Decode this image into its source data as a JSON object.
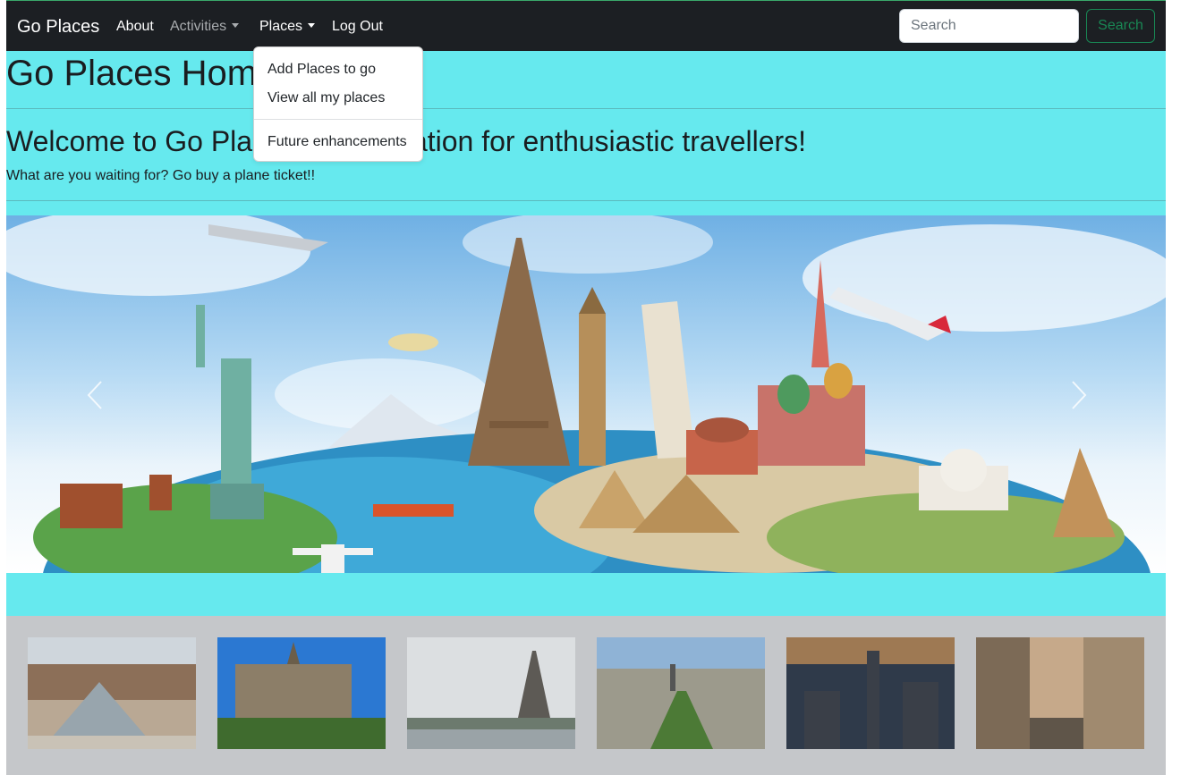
{
  "navbar": {
    "brand": "Go Places",
    "links": [
      {
        "label": "About"
      },
      {
        "label": "Activities"
      },
      {
        "label": "Places"
      },
      {
        "label": "Log Out"
      }
    ],
    "search": {
      "placeholder": "Search",
      "button_label": "Search"
    }
  },
  "dropdown": {
    "items": [
      {
        "label": "Add Places to go"
      },
      {
        "label": "View all my places"
      },
      {
        "label": "Future enhancements"
      }
    ]
  },
  "main": {
    "title": "Go Places Home",
    "welcome": "Welcome to Go Places, a application for enthusiastic travellers!",
    "lead": "What are you waiting for? Go buy a plane ticket!!"
  },
  "carousel": {
    "image": "travel-landmarks-collage",
    "controls": {
      "prev_icon": "chevron-left-icon",
      "next_icon": "chevron-right-icon"
    }
  },
  "thumbnails": [
    {
      "image": "louvre-pyramid"
    },
    {
      "image": "notre-dame"
    },
    {
      "image": "eiffel-tower-river"
    },
    {
      "image": "paris-aerial"
    },
    {
      "image": "city-skyline-dusk"
    },
    {
      "image": "paris-street"
    }
  ],
  "colors": {
    "page_background": "#66e9ee",
    "navbar_background": "#1c1f23",
    "search_button": "#198754",
    "thumb_strip": "#c5c7ca"
  }
}
